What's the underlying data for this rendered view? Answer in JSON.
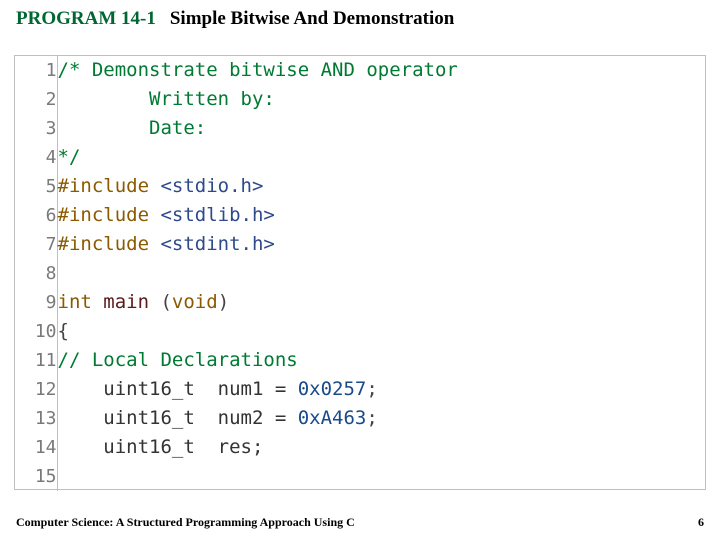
{
  "header": {
    "program_number": "PROGRAM 14-1",
    "title": "Simple Bitwise And Demonstration"
  },
  "code": {
    "lines": [
      {
        "n": 1,
        "tokens": [
          {
            "t": "/* Demonstrate bitwise AND operator",
            "c": "tok-comment"
          }
        ]
      },
      {
        "n": 2,
        "tokens": [
          {
            "t": "        Written by:",
            "c": "tok-comment"
          }
        ]
      },
      {
        "n": 3,
        "tokens": [
          {
            "t": "        Date:",
            "c": "tok-comment"
          }
        ]
      },
      {
        "n": 4,
        "tokens": [
          {
            "t": "*/",
            "c": "tok-comment"
          }
        ]
      },
      {
        "n": 5,
        "tokens": [
          {
            "t": "#include ",
            "c": "tok-keyword"
          },
          {
            "t": "<stdio.h>",
            "c": "tok-angle"
          }
        ]
      },
      {
        "n": 6,
        "tokens": [
          {
            "t": "#include ",
            "c": "tok-keyword"
          },
          {
            "t": "<stdlib.h>",
            "c": "tok-angle"
          }
        ]
      },
      {
        "n": 7,
        "tokens": [
          {
            "t": "#include ",
            "c": "tok-keyword"
          },
          {
            "t": "<stdint.h>",
            "c": "tok-angle"
          }
        ]
      },
      {
        "n": 8,
        "tokens": [
          {
            "t": "",
            "c": ""
          }
        ]
      },
      {
        "n": 9,
        "tokens": [
          {
            "t": "int ",
            "c": "tok-keyword"
          },
          {
            "t": "main ",
            "c": "tok-func"
          },
          {
            "t": "(",
            "c": "tok-punct"
          },
          {
            "t": "void",
            "c": "tok-keyword"
          },
          {
            "t": ")",
            "c": "tok-punct"
          }
        ]
      },
      {
        "n": 10,
        "tokens": [
          {
            "t": "{",
            "c": "tok-punct"
          }
        ]
      },
      {
        "n": 11,
        "tokens": [
          {
            "t": "// Local Declarations",
            "c": "tok-comment"
          }
        ]
      },
      {
        "n": 12,
        "tokens": [
          {
            "t": "    uint16_t  num1 = ",
            "c": "tok-type"
          },
          {
            "t": "0x0257",
            "c": "tok-num"
          },
          {
            "t": ";",
            "c": "tok-punct"
          }
        ]
      },
      {
        "n": 13,
        "tokens": [
          {
            "t": "    uint16_t  num2 = ",
            "c": "tok-type"
          },
          {
            "t": "0xA463",
            "c": "tok-num"
          },
          {
            "t": ";",
            "c": "tok-punct"
          }
        ]
      },
      {
        "n": 14,
        "tokens": [
          {
            "t": "    uint16_t  res;",
            "c": "tok-type"
          }
        ]
      },
      {
        "n": 15,
        "tokens": [
          {
            "t": "",
            "c": ""
          }
        ]
      }
    ]
  },
  "footer": {
    "book_title": "Computer Science: A Structured Programming Approach Using C",
    "page_number": "6"
  }
}
